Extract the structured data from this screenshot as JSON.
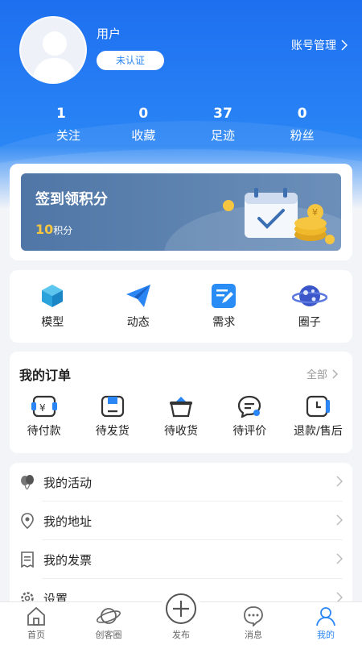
{
  "profile": {
    "username": "用户",
    "verify_status": "未认证",
    "account_manage": "账号管理"
  },
  "stats": [
    {
      "value": "1",
      "label": "关注"
    },
    {
      "value": "0",
      "label": "收藏"
    },
    {
      "value": "37",
      "label": "足迹"
    },
    {
      "value": "0",
      "label": "粉丝"
    }
  ],
  "signin": {
    "title": "签到领积分",
    "points": "10",
    "points_unit": "积分"
  },
  "quick": [
    {
      "label": "模型",
      "icon": "cube-icon"
    },
    {
      "label": "动态",
      "icon": "paper-plane-icon"
    },
    {
      "label": "需求",
      "icon": "edit-note-icon"
    },
    {
      "label": "圈子",
      "icon": "planet-icon"
    }
  ],
  "orders": {
    "title": "我的订单",
    "all_label": "全部",
    "items": [
      {
        "label": "待付款",
        "icon": "payment-icon"
      },
      {
        "label": "待发货",
        "icon": "box-icon"
      },
      {
        "label": "待收货",
        "icon": "basket-icon"
      },
      {
        "label": "待评价",
        "icon": "comment-icon"
      },
      {
        "label": "退款/售后",
        "icon": "refund-icon"
      }
    ]
  },
  "menu": [
    {
      "label": "我的活动",
      "icon": "balloon-icon"
    },
    {
      "label": "我的地址",
      "icon": "location-icon"
    },
    {
      "label": "我的发票",
      "icon": "invoice-icon"
    },
    {
      "label": "设置",
      "icon": "gear-icon"
    }
  ],
  "tabs": [
    {
      "label": "首页",
      "icon": "home-icon"
    },
    {
      "label": "创客圈",
      "icon": "planet-icon"
    },
    {
      "label": "发布",
      "icon": "plus-icon"
    },
    {
      "label": "消息",
      "icon": "message-icon"
    },
    {
      "label": "我的",
      "icon": "user-icon"
    }
  ],
  "colors": {
    "primary": "#2a86f5",
    "header_top": "#1e6ff0",
    "accent_gold": "#f6c640",
    "background": "#f3f4f8"
  }
}
